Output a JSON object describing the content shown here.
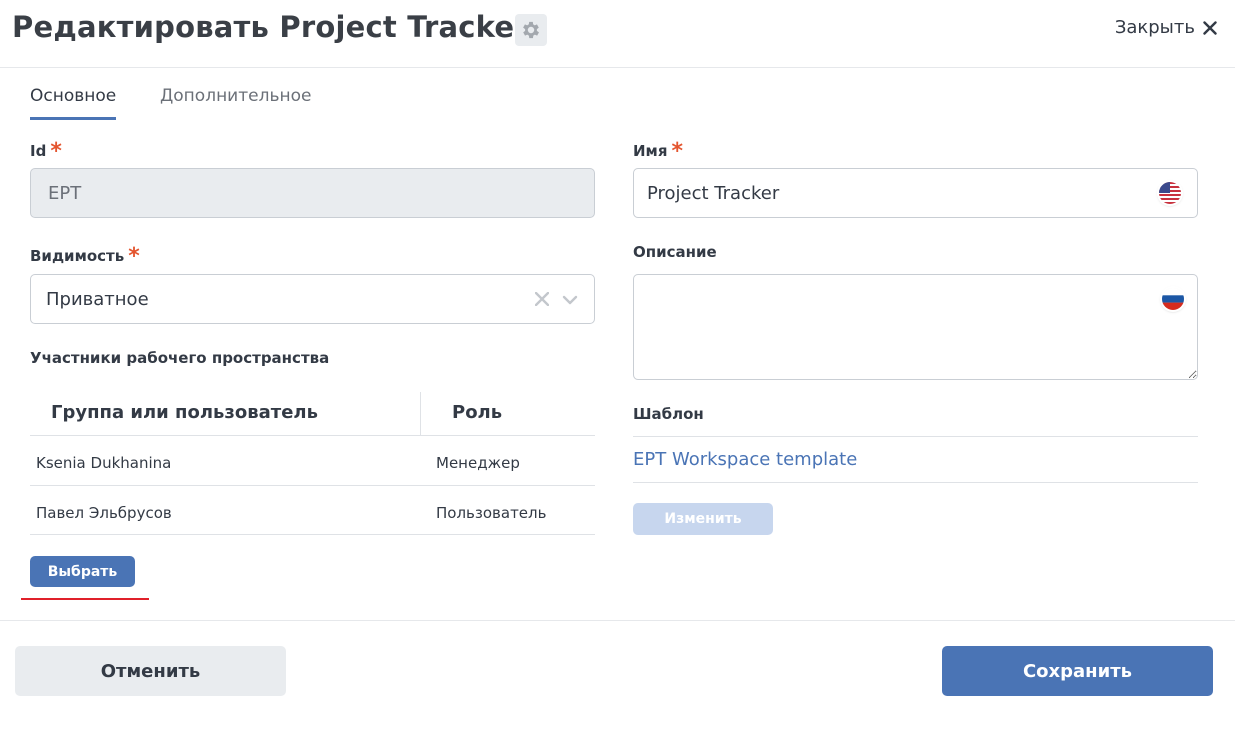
{
  "header": {
    "title": "Редактировать Project Tracker",
    "close_label": "Закрыть"
  },
  "tabs": [
    {
      "label": "Основное",
      "active": true
    },
    {
      "label": "Дополнительное",
      "active": false
    }
  ],
  "fields": {
    "id": {
      "label": "Id",
      "required_mark": "*",
      "value": "EPT"
    },
    "name": {
      "label": "Имя",
      "required_mark": "*",
      "value": "Project Tracker",
      "lang_icon": "us-flag-icon"
    },
    "visibility": {
      "label": "Видимость",
      "required_mark": "*",
      "value": "Приватное"
    },
    "description": {
      "label": "Описание",
      "value": "",
      "lang_icon": "ru-flag-icon"
    },
    "template": {
      "label": "Шаблон",
      "value": "EPT Workspace template",
      "change_label": "Изменить"
    }
  },
  "members": {
    "label": "Участники рабочего пространства",
    "columns": [
      "Группа или пользователь",
      "Роль"
    ],
    "rows": [
      {
        "user": "Ksenia Dukhanina",
        "role": "Менеджер"
      },
      {
        "user": "Павел Эльбрусов",
        "role": "Пользователь"
      }
    ],
    "select_label": "Выбрать"
  },
  "footer": {
    "cancel_label": "Отменить",
    "save_label": "Сохранить"
  },
  "colors": {
    "accent": "#4a74b5",
    "required": "#e4552f",
    "underline_annotation": "#e0202a"
  }
}
